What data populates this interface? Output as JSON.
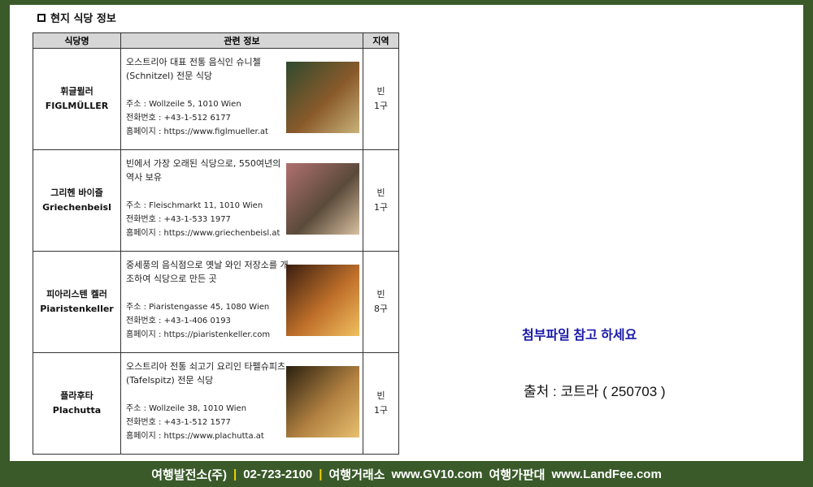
{
  "heading": "현지 식당 정보",
  "table": {
    "headers": [
      "식당명",
      "관련 정보",
      "지역"
    ],
    "rows": [
      {
        "name_ko": "휘글뮐러",
        "name_en": "FIGLMÜLLER",
        "desc": "오스트리아 대표 전통 음식인 슈니첼(Schnitzel) 전문 식당",
        "address": "주소 : Wollzeile 5, 1010 Wien",
        "phone": "전화번호 : +43-1-512 6177",
        "homepage": "홈페이지 : https://www.figlmueller.at",
        "region": "빈 1구",
        "photo_colors": [
          "#2f4a2e",
          "#8a5a2b",
          "#c8b27a"
        ]
      },
      {
        "name_ko": "그리헨 바이즐",
        "name_en": "Griechenbeisl",
        "desc": "빈에서 가장 오래된 식당으로, 550여년의 역사 보유",
        "address": "주소 : Fleischmarkt 11, 1010 Wien",
        "phone": "전화번호 : +43-1-533 1977",
        "homepage": "홈페이지 : https://www.griechenbeisl.at",
        "region": "빈 1구",
        "photo_colors": [
          "#b07070",
          "#5a4a3a",
          "#d8c0a0"
        ]
      },
      {
        "name_ko": "피아리스텐 켈러",
        "name_en": "Piaristenkeller",
        "desc": "중세풍의 음식점으로 옛날 와인 저장소를 개조하여 식당으로 만든 곳",
        "address": "주소 : Piaristengasse 45, 1080 Wien",
        "phone": "전화번호 : +43-1-406 0193",
        "homepage": "홈페이지 : https://piaristenkeller.com",
        "region": "빈 8구",
        "photo_colors": [
          "#3a1e10",
          "#c0702a",
          "#f0c060"
        ]
      },
      {
        "name_ko": "플라후타",
        "name_en": "Plachutta",
        "desc": "오스트리아 전통 쇠고기 요리인 타펠슈피츠(Tafelspitz) 전문 식당",
        "address": "주소 : Wollzeile 38, 1010 Wien",
        "phone": "전화번호 : +43-1-512 1577",
        "homepage": "홈페이지 : https://www.plachutta.at",
        "region": "빈 1구",
        "photo_colors": [
          "#2a2010",
          "#b08040",
          "#e8c070"
        ]
      }
    ]
  },
  "note_attachment": "첨부파일 참고 하세요",
  "note_source": "출처 : 코트라 ( 250703 )",
  "footer": {
    "company": "여행발전소(주)",
    "phone": "02-723-2100",
    "exchange": "여행거래소",
    "site1": "www.GV10.com",
    "market": "여행가판대",
    "site2": "www.LandFee.com"
  },
  "colors": {
    "background": "#3a5a2a",
    "header_fill": "#d6d6d6",
    "note_blue": "#1a1aa8",
    "separator": "#f5d400"
  }
}
